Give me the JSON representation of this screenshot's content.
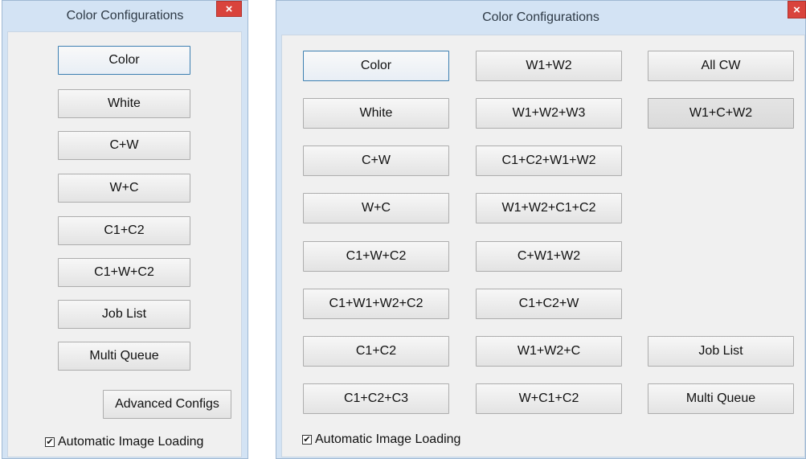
{
  "small_window": {
    "title": "Color Configurations",
    "close_glyph": "×",
    "buttons": [
      "Color",
      "White",
      "C+W",
      "W+C",
      "C1+C2",
      "C1+W+C2",
      "Job List",
      "Multi Queue"
    ],
    "advanced_label": "Advanced Configs",
    "checkbox_label": "Automatic Image Loading",
    "checkbox_checked": true
  },
  "large_window": {
    "title": "Color Configurations",
    "close_glyph": "×",
    "col1": [
      "Color",
      "White",
      "C+W",
      "W+C",
      "C1+W+C2",
      "C1+W1+W2+C2",
      "C1+C2",
      "C1+C2+C3"
    ],
    "col2": [
      "W1+W2",
      "W1+W2+W3",
      "C1+C2+W1+W2",
      "W1+W2+C1+C2",
      "C+W1+W2",
      "C1+C2+W",
      "W1+W2+C",
      "W+C1+C2"
    ],
    "col3": [
      "All CW",
      "W1+C+W2",
      "Job List",
      "Multi Queue"
    ],
    "checkbox_label": "Automatic Image Loading",
    "checkbox_checked": true
  },
  "icons": {
    "close": "close-icon",
    "check": "check-icon"
  },
  "colors": {
    "frame": "#d3e3f4",
    "close": "#d9433c",
    "focus": "#3c7fb1"
  }
}
